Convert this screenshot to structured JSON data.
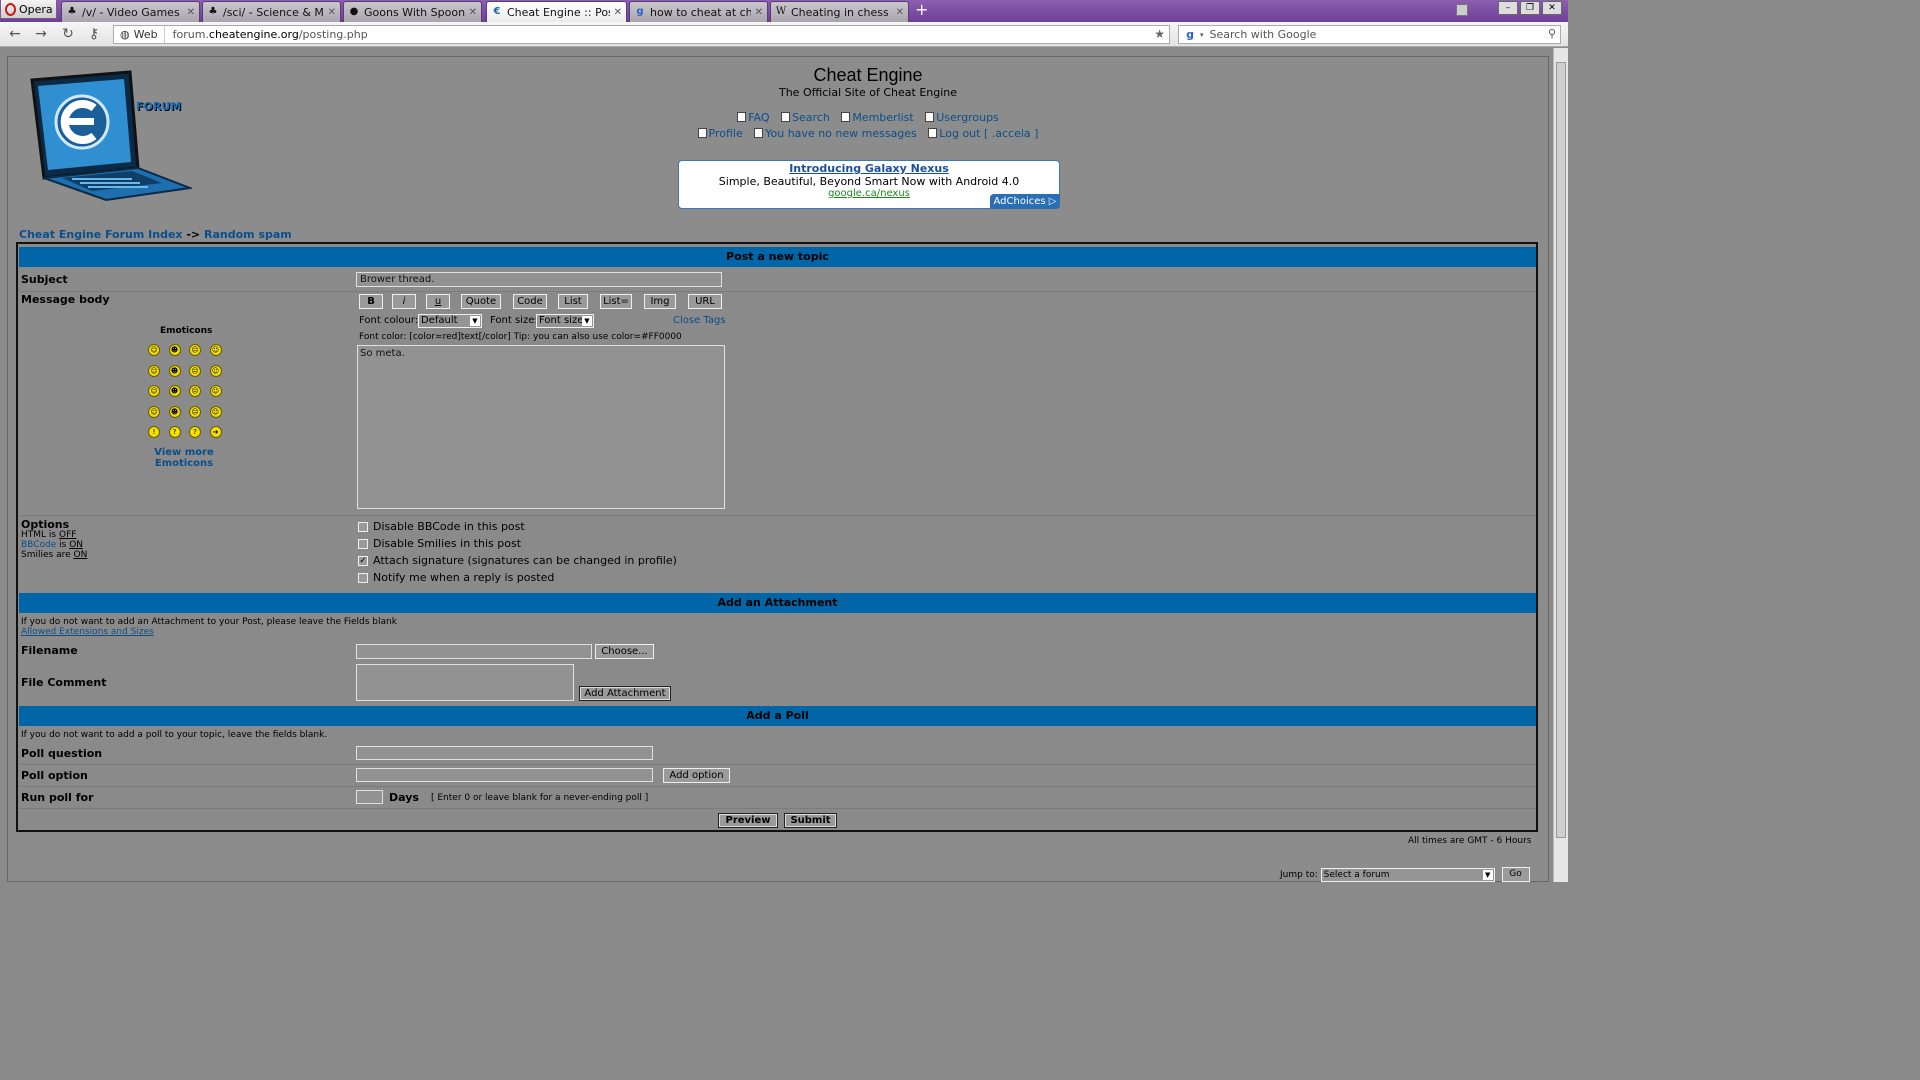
{
  "browser": {
    "opera_label": "Opera",
    "tabs": [
      {
        "label": "/v/ - Video Games"
      },
      {
        "label": "/sci/ - Science & Math"
      },
      {
        "label": "Goons With Spoons - T..."
      },
      {
        "label": "Cheat Engine :: Post a ..."
      },
      {
        "label": "how to cheat at chess -..."
      },
      {
        "label": "Cheating in chess - Wi..."
      }
    ],
    "web_label": "Web",
    "url_prefix": "forum.",
    "url_domain": "cheatengine.org",
    "url_path": "/posting.php",
    "search_placeholder": "Search with Google"
  },
  "site": {
    "title": "Cheat Engine",
    "subtitle": "The Official Site of Cheat Engine",
    "logo_text": "FORUM",
    "links_row1": [
      "FAQ",
      "Search",
      "Memberlist",
      "Usergroups"
    ],
    "links_row2": [
      "Profile",
      "You have no new messages",
      "Log out [ .accela ]"
    ]
  },
  "ad": {
    "title": "Introducing Galaxy Nexus",
    "text": "Simple, Beautiful, Beyond Smart Now with Android 4.0",
    "url": "google.ca/nexus",
    "choices": "AdChoices ▷"
  },
  "breadcrumb": {
    "index": "Cheat Engine Forum Index",
    "sep": "->",
    "forum": "Random spam"
  },
  "post": {
    "header": "Post a new topic",
    "subject_label": "Subject",
    "subject_value": "Brower thread.",
    "message_label": "Message body",
    "bbcode_buttons": [
      "B",
      "i",
      "u",
      "Quote",
      "Code",
      "List",
      "List=",
      "Img",
      "URL"
    ],
    "font_colour_label": "Font colour:",
    "font_colour_value": "Default",
    "font_size_label": "Font size:",
    "font_size_value": "Font size",
    "close_tags": "Close Tags",
    "help_text": "Font color: [color=red]text[/color]  Tip: you can also use color=#FF0000",
    "message_value": "So meta.",
    "emoticons_label": "Emoticons",
    "view_more": "View more Emoticons",
    "options_label": "Options",
    "html_status": "HTML is",
    "html_value": "OFF",
    "bbcode_status_link": "BBCode",
    "bbcode_status": "is",
    "bbcode_value": "ON",
    "smilies_status": "Smilies are",
    "smilies_value": "ON",
    "checkboxes": [
      {
        "label": "Disable BBCode in this post",
        "checked": false
      },
      {
        "label": "Disable Smilies in this post",
        "checked": false
      },
      {
        "label": "Attach signature (signatures can be changed in profile)",
        "checked": true
      },
      {
        "label": "Notify me when a reply is posted",
        "checked": false
      }
    ]
  },
  "attachment": {
    "header": "Add an Attachment",
    "note": "If you do not want to add an Attachment to your Post, please leave the Fields blank",
    "allowed": "Allowed Extensions and Sizes",
    "filename_label": "Filename",
    "choose": "Choose...",
    "comment_label": "File Comment",
    "add": "Add Attachment"
  },
  "poll": {
    "header": "Add a Poll",
    "note": "If you do not want to add a poll to your topic, leave the fields blank.",
    "question_label": "Poll question",
    "option_label": "Poll option",
    "add_option": "Add option",
    "run_label": "Run poll for",
    "days": "Days",
    "days_note": "[ Enter 0 or leave blank for a never-ending poll ]"
  },
  "actions": {
    "preview": "Preview",
    "submit": "Submit"
  },
  "footer": {
    "times": "All times are GMT - 6 Hours",
    "jump_label": "Jump to:",
    "jump_value": "Select a forum",
    "go": "Go"
  }
}
